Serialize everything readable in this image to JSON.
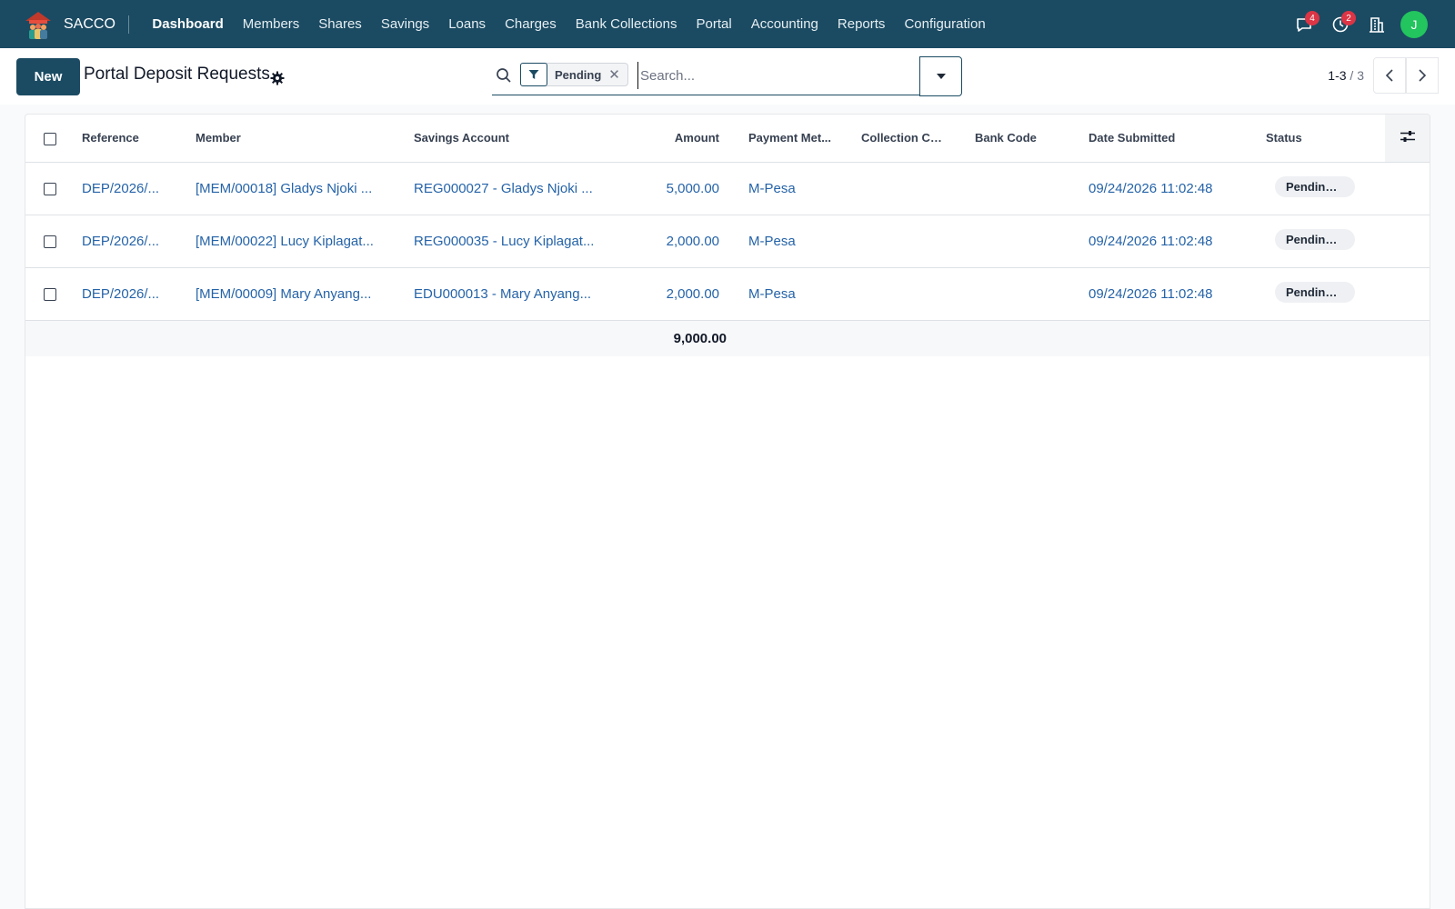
{
  "app": {
    "name": "SACCO",
    "menu": [
      "Dashboard",
      "Members",
      "Shares",
      "Savings",
      "Loans",
      "Charges",
      "Bank Collections",
      "Portal",
      "Accounting",
      "Reports",
      "Configuration"
    ],
    "active_menu": "Dashboard",
    "systray": {
      "messages_count": "4",
      "activities_count": "2",
      "user_initial": "J"
    }
  },
  "control_panel": {
    "new_label": "New",
    "title": "Portal Deposit Requests",
    "search": {
      "facet_value": "Pending",
      "placeholder": "Search..."
    },
    "pager": {
      "range": "1-3",
      "total": "3"
    }
  },
  "table": {
    "columns": [
      "Reference",
      "Member",
      "Savings Account",
      "Amount",
      "Payment Met...",
      "Collection Ch...",
      "Bank Code",
      "Date Submitted",
      "Status"
    ],
    "rows": [
      {
        "reference": "DEP/2026/...",
        "member": "[MEM/00018] Gladys Njoki ...",
        "account": "REG000027 - Gladys Njoki ...",
        "amount": "5,000.00",
        "payment_method": "M-Pesa",
        "collection_channel": "",
        "bank_code": "",
        "date_submitted": "09/24/2026 11:02:48",
        "status": "Pending ..."
      },
      {
        "reference": "DEP/2026/...",
        "member": "[MEM/00022] Lucy Kiplagat...",
        "account": "REG000035 - Lucy Kiplagat...",
        "amount": "2,000.00",
        "payment_method": "M-Pesa",
        "collection_channel": "",
        "bank_code": "",
        "date_submitted": "09/24/2026 11:02:48",
        "status": "Pending ..."
      },
      {
        "reference": "DEP/2026/...",
        "member": "[MEM/00009] Mary Anyang...",
        "account": "EDU000013 - Mary Anyang...",
        "amount": "2,000.00",
        "payment_method": "M-Pesa",
        "collection_channel": "",
        "bank_code": "",
        "date_submitted": "09/24/2026 11:02:48",
        "status": "Pending ..."
      }
    ],
    "total_amount": "9,000.00"
  },
  "colors": {
    "navbar": "#1b4b63",
    "link": "#2563a8",
    "avatar": "#22c55e",
    "badge_red": "#dc3545"
  }
}
